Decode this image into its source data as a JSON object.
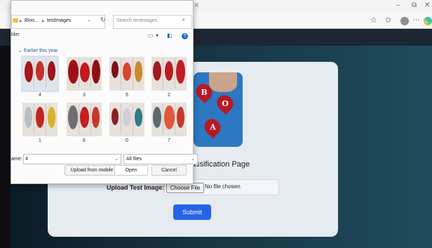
{
  "browser": {
    "minimize_glyph": "–",
    "restore_glyph": "⧉",
    "close_glyph": "✕",
    "star_glyph": "☆",
    "favorites_glyph": "✩",
    "more_glyph": "…",
    "icons": [
      "star-icon",
      "favorites-icon",
      "profile-icon",
      "more-icon",
      "edge-icon"
    ]
  },
  "page": {
    "title": "Blood Group Classification Page",
    "title_visible": "assification Page",
    "upload_label": "Upload Test Image:",
    "choose_file": "Choose File",
    "no_file": "No file chosen",
    "submit": "Submit",
    "hero_letters": [
      "B",
      "O",
      "A"
    ]
  },
  "dialog": {
    "close_glyph": "✕",
    "path": [
      "Bloo...",
      "testImages"
    ],
    "search_placeholder": "Search testImages",
    "folder_label": "lder",
    "group": "Earlier this year",
    "images": [
      {
        "label": "4"
      },
      {
        "label": "3"
      },
      {
        "label": "5"
      },
      {
        "label": "2"
      },
      {
        "label": "1"
      },
      {
        "label": "6"
      },
      {
        "label": "0"
      },
      {
        "label": "7"
      }
    ],
    "filename_label": "ame:",
    "filename_value": "4",
    "filter": "All files",
    "upload_mobile": "Upload from mobile",
    "open": "Open",
    "cancel": "Cancel"
  },
  "colors": {
    "submit": "#2563eb",
    "blood": "#b51a24",
    "card": "#e6ebef"
  }
}
